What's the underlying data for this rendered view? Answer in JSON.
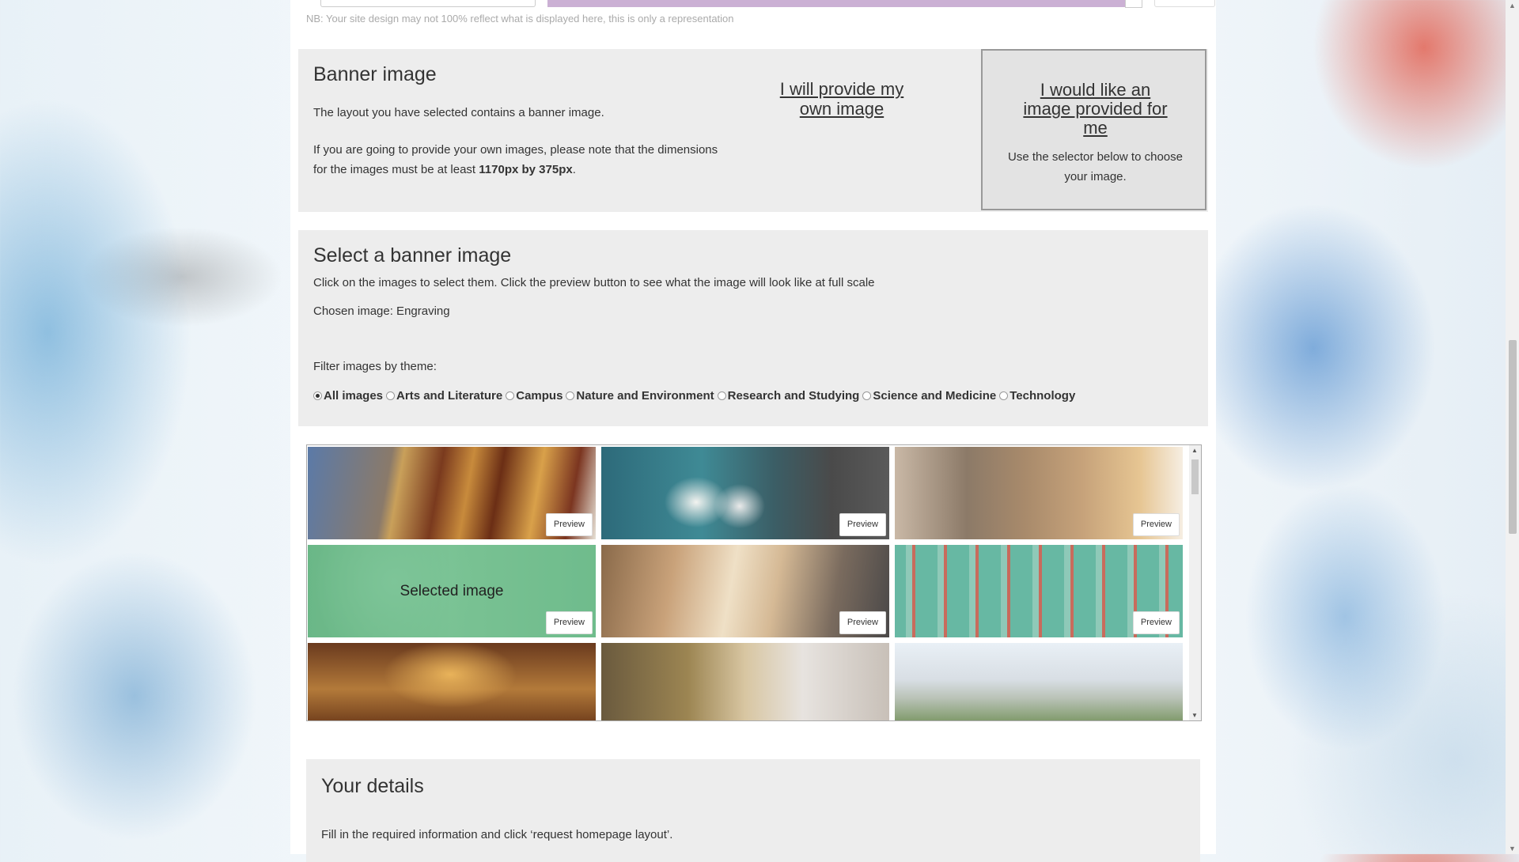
{
  "top": {
    "notice": "NB: Your site design may not 100% reflect what is displayed here, this is only a representation"
  },
  "banner": {
    "title": "Banner image",
    "line1": "The layout you have selected contains a banner image.",
    "line2a": "If you are going to provide your own images, please note that the dimensions",
    "line2b_prefix": "for the images must be at least ",
    "line2b_bold": "1170px by 375px",
    "line2b_suffix": ".",
    "option_own": "I will provide my own image",
    "option_provided_title": "I would like an image provided for me",
    "option_provided_desc": "Use the selector below to choose your image."
  },
  "select": {
    "title": "Select a banner image",
    "instruction": "Click on the images to select them. Click the preview button to see what the image will look like at full scale",
    "chosen": "Chosen image: Engraving",
    "filter_label": "Filter images by theme:",
    "themes": [
      {
        "label": "All images",
        "checked": true
      },
      {
        "label": "Arts and Literature",
        "checked": false
      },
      {
        "label": "Campus",
        "checked": false
      },
      {
        "label": "Nature and Environment",
        "checked": false
      },
      {
        "label": "Research and Studying",
        "checked": false
      },
      {
        "label": "Science and Medicine",
        "checked": false
      },
      {
        "label": "Technology",
        "checked": false
      }
    ]
  },
  "gallery": {
    "preview_label": "Preview",
    "selected_label": "Selected image"
  },
  "details": {
    "title": "Your details",
    "instruction": "Fill in the required information and click ‘request homepage layout’."
  },
  "colors": {
    "panel": "#ededed",
    "accent_purple": "#cbb0d4"
  }
}
